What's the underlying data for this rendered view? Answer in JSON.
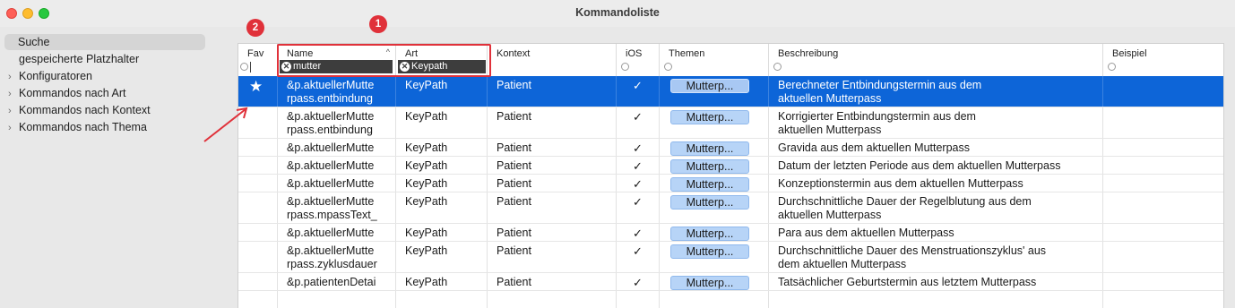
{
  "window": {
    "title": "Kommandoliste"
  },
  "sidebar": {
    "items": [
      {
        "label": "Suche",
        "expandable": false,
        "selected": true
      },
      {
        "label": "gespeicherte Platzhalter",
        "expandable": false,
        "selected": false
      },
      {
        "label": "Konfiguratoren",
        "expandable": true,
        "selected": false
      },
      {
        "label": "Kommandos nach Art",
        "expandable": true,
        "selected": false
      },
      {
        "label": "Kommandos nach Kontext",
        "expandable": true,
        "selected": false
      },
      {
        "label": "Kommandos nach Thema",
        "expandable": true,
        "selected": false
      }
    ]
  },
  "table": {
    "columns": {
      "fav": "Fav",
      "name": "Name",
      "art": "Art",
      "kontext": "Kontext",
      "ios": "iOS",
      "themen": "Themen",
      "beschreibung": "Beschreibung",
      "beispiel": "Beispiel"
    },
    "filters": {
      "name": "mutter",
      "art": "Keypath"
    },
    "rows": [
      {
        "fav": "★",
        "name": "&p.aktuellerMutte\nrpass.entbindung",
        "art": "KeyPath",
        "kontext": "Patient",
        "ios": "✓",
        "themen": "Mutterp...",
        "beschreibung": "Berechneter Entbindungstermin aus dem\naktuellen Mutterpass",
        "beispiel": "",
        "selected": true
      },
      {
        "fav": "",
        "name": "&p.aktuellerMutte\nrpass.entbindung",
        "art": "KeyPath",
        "kontext": "Patient",
        "ios": "✓",
        "themen": "Mutterp...",
        "beschreibung": "Korrigierter Entbindungstermin aus dem\naktuellen Mutterpass",
        "beispiel": "",
        "selected": false
      },
      {
        "fav": "",
        "name": "&p.aktuellerMutte",
        "art": "KeyPath",
        "kontext": "Patient",
        "ios": "✓",
        "themen": "Mutterp...",
        "beschreibung": "Gravida aus dem aktuellen Mutterpass",
        "beispiel": "",
        "selected": false
      },
      {
        "fav": "",
        "name": "&p.aktuellerMutte",
        "art": "KeyPath",
        "kontext": "Patient",
        "ios": "✓",
        "themen": "Mutterp...",
        "beschreibung": "Datum der letzten Periode aus dem aktuellen Mutterpass",
        "beispiel": "",
        "selected": false
      },
      {
        "fav": "",
        "name": "&p.aktuellerMutte",
        "art": "KeyPath",
        "kontext": "Patient",
        "ios": "✓",
        "themen": "Mutterp...",
        "beschreibung": "Konzeptionstermin aus dem aktuellen Mutterpass",
        "beispiel": "",
        "selected": false
      },
      {
        "fav": "",
        "name": "&p.aktuellerMutte\nrpass.mpassText_",
        "art": "KeyPath",
        "kontext": "Patient",
        "ios": "✓",
        "themen": "Mutterp...",
        "beschreibung": "Durchschnittliche Dauer der Regelblutung aus dem\naktuellen Mutterpass",
        "beispiel": "",
        "selected": false
      },
      {
        "fav": "",
        "name": "&p.aktuellerMutte",
        "art": "KeyPath",
        "kontext": "Patient",
        "ios": "✓",
        "themen": "Mutterp...",
        "beschreibung": "Para aus dem aktuellen Mutterpass",
        "beispiel": "",
        "selected": false
      },
      {
        "fav": "",
        "name": "&p.aktuellerMutte\nrpass.zyklusdauer",
        "art": "KeyPath",
        "kontext": "Patient",
        "ios": "✓",
        "themen": "Mutterp...",
        "beschreibung": "Durchschnittliche Dauer des Menstruationszyklus' aus\ndem aktuellen Mutterpass",
        "beispiel": "",
        "selected": false
      },
      {
        "fav": "",
        "name": "&p.patientenDetai",
        "art": "KeyPath",
        "kontext": "Patient",
        "ios": "✓",
        "themen": "Mutterp...",
        "beschreibung": "Tatsächlicher Geburtstermin aus letztem Mutterpass",
        "beispiel": "",
        "selected": false
      },
      {
        "fav": "",
        "name": "",
        "art": "",
        "kontext": "",
        "ios": "",
        "themen": "",
        "beschreibung": "",
        "beispiel": "",
        "selected": false
      }
    ]
  },
  "annotations": {
    "badge1": "1",
    "badge2": "2",
    "color": "#e0313a"
  },
  "colors": {
    "selection": "#0d65d8",
    "tag": "#b7d4f7"
  }
}
